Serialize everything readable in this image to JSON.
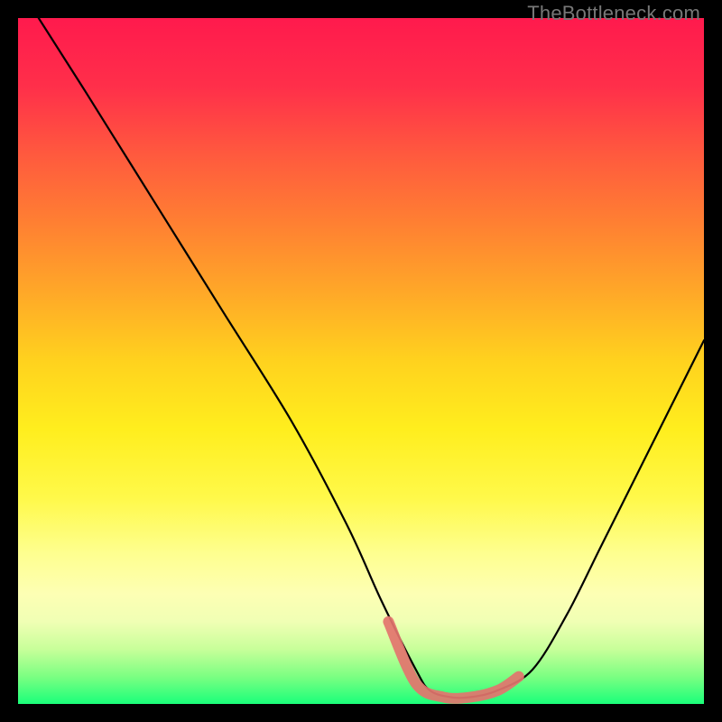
{
  "watermark": "TheBottleneck.com",
  "chart_data": {
    "type": "line",
    "title": "",
    "xlabel": "",
    "ylabel": "",
    "xlim": [
      0,
      100
    ],
    "ylim": [
      0,
      100
    ],
    "series": [
      {
        "name": "curve",
        "x": [
          3,
          10,
          20,
          30,
          40,
          48,
          53,
          58,
          60,
          63,
          66,
          70,
          75,
          80,
          85,
          90,
          95,
          100
        ],
        "values": [
          100,
          89,
          73,
          57,
          41,
          26,
          15,
          5,
          2,
          1,
          1,
          2,
          5,
          13,
          23,
          33,
          43,
          53
        ]
      }
    ],
    "annotations": {
      "highlight_segment": {
        "color": "#e3746e",
        "x": [
          54,
          58,
          62,
          66,
          70,
          73
        ],
        "values": [
          12,
          3,
          1,
          1,
          2,
          4
        ]
      }
    },
    "background_gradient_stops": [
      {
        "pos": 0,
        "color": "#ff1a4d"
      },
      {
        "pos": 50,
        "color": "#ffd21e"
      },
      {
        "pos": 78,
        "color": "#feff8f"
      },
      {
        "pos": 100,
        "color": "#1aff7a"
      }
    ]
  }
}
